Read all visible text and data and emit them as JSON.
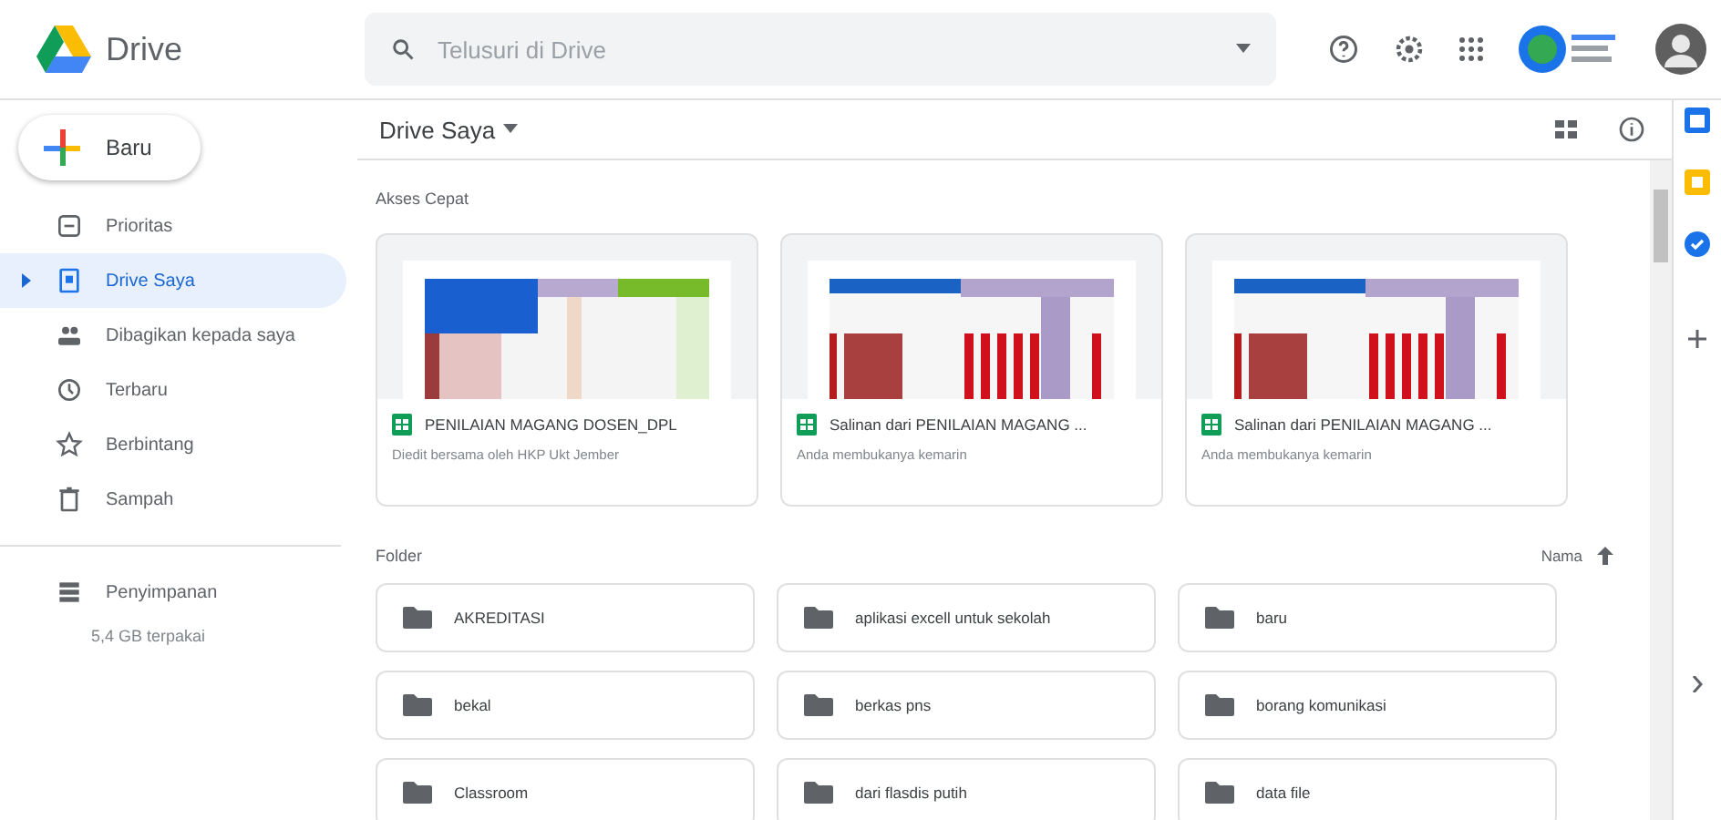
{
  "header": {
    "app_name": "Drive",
    "search": {
      "placeholder": "Telusuri di Drive"
    }
  },
  "sidebar": {
    "new_button": "Baru",
    "items": [
      {
        "label": "Prioritas",
        "selected": false
      },
      {
        "label": "Drive Saya",
        "selected": true
      },
      {
        "label": "Dibagikan kepada saya",
        "selected": false
      },
      {
        "label": "Terbaru",
        "selected": false
      },
      {
        "label": "Berbintang",
        "selected": false
      },
      {
        "label": "Sampah",
        "selected": false
      }
    ],
    "storage": {
      "label": "Penyimpanan",
      "usage": "5,4 GB terpakai"
    }
  },
  "main": {
    "title": "Drive Saya",
    "quick_access": {
      "title": "Akses Cepat",
      "cards": [
        {
          "name": "PENILAIAN MAGANG DOSEN_DPL",
          "detail": "Diedit bersama oleh HKP Ukt Jember",
          "kind": "picture"
        },
        {
          "name": "Salinan dari PENILAIAN MAGANG ...",
          "detail": "Anda membukanya kemarin",
          "kind": "picture"
        },
        {
          "name": "Salinan dari PENILAIAN MAGANG ...",
          "detail": "Anda membukanya kemarin",
          "kind": "picture"
        }
      ]
    },
    "folders": {
      "title": "Folder",
      "sort_label": "Nama",
      "items": [
        {
          "name": "AKREDITASI"
        },
        {
          "name": "aplikasi excell untuk sekolah"
        },
        {
          "name": "baru"
        },
        {
          "name": "bekal"
        },
        {
          "name": "berkas pns"
        },
        {
          "name": "borang komunikasi"
        },
        {
          "name": "Classroom"
        },
        {
          "name": "dari flasdis putih"
        },
        {
          "name": "data file"
        }
      ]
    }
  }
}
